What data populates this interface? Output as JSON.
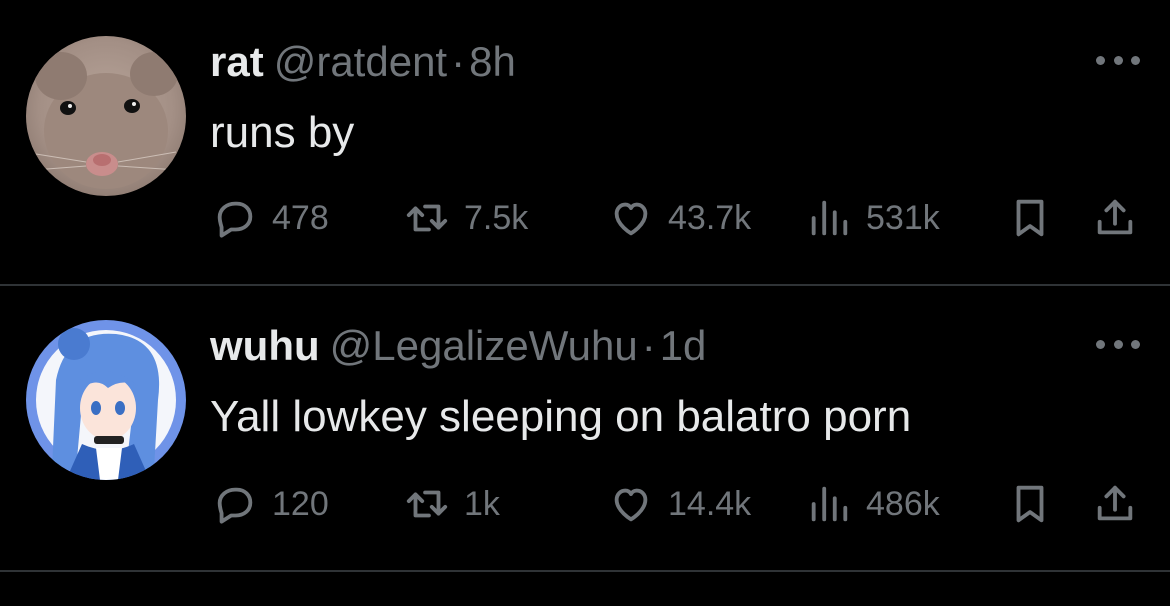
{
  "tweets": [
    {
      "name": "rat",
      "handle": "@ratdent",
      "separator": "·",
      "time": "8h",
      "text": "runs by",
      "stats": {
        "replies": "478",
        "retweets": "7.5k",
        "likes": "43.7k",
        "views": "531k"
      }
    },
    {
      "name": "wuhu",
      "handle": "@LegalizeWuhu",
      "separator": "·",
      "time": "1d",
      "text": "Yall lowkey sleeping on balatro porn",
      "stats": {
        "replies": "120",
        "retweets": "1k",
        "likes": "14.4k",
        "views": "486k"
      }
    }
  ],
  "colors": {
    "background": "#000000",
    "primary_text": "#e7e9ea",
    "secondary_text": "#71767b",
    "divider": "#2f3336"
  },
  "icons": [
    "more-icon",
    "reply-icon",
    "retweet-icon",
    "like-icon",
    "views-icon",
    "bookmark-icon",
    "share-icon"
  ]
}
